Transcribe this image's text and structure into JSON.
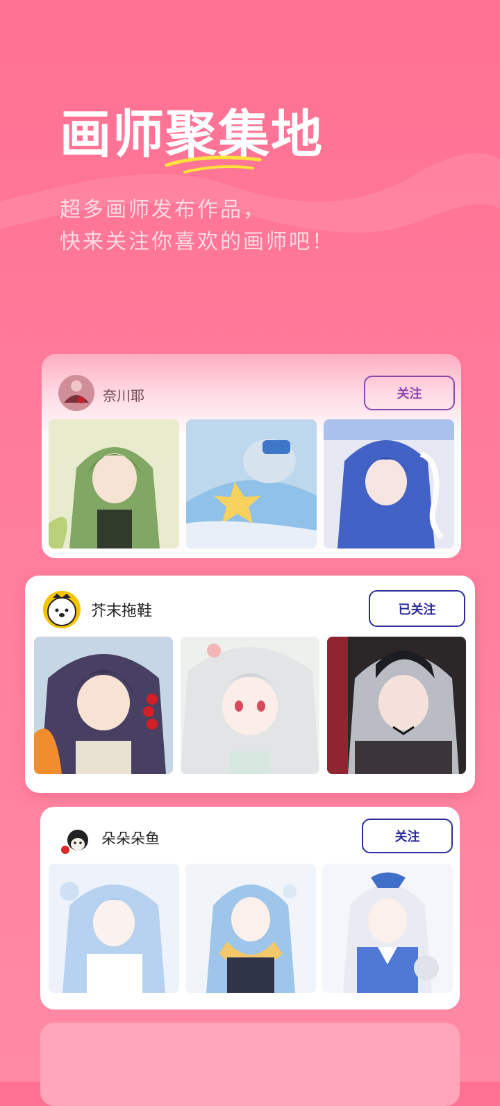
{
  "hero": {
    "title": "画师聚集地",
    "subtitle_line1": "超多画师发布作品，",
    "subtitle_line2": "快来关注你喜欢的画师吧！"
  },
  "colors": {
    "background": "#ff7193",
    "follow_button_faded": "#8e44ad",
    "follow_button": "#2b2b9b",
    "underline": "#ffe23a"
  },
  "cards": [
    {
      "artist": "奈川耶",
      "button": "关注",
      "thumbnails": [
        "green-haired character artwork",
        "sleeping blue-haired character with star pillow",
        "blue-haired character with white cat"
      ]
    },
    {
      "artist": "芥末拖鞋",
      "button": "已关注",
      "thumbnails": [
        "dark-haired character with candied fruit",
        "white-haired character with pink eyes",
        "silver-haired character in black dress"
      ]
    },
    {
      "artist": "朵朵朵鱼",
      "button": "关注",
      "thumbnails": [
        "light-blue twin-tail character",
        "blue-haired character with scarf",
        "white-haired character in blue uniform"
      ]
    }
  ]
}
